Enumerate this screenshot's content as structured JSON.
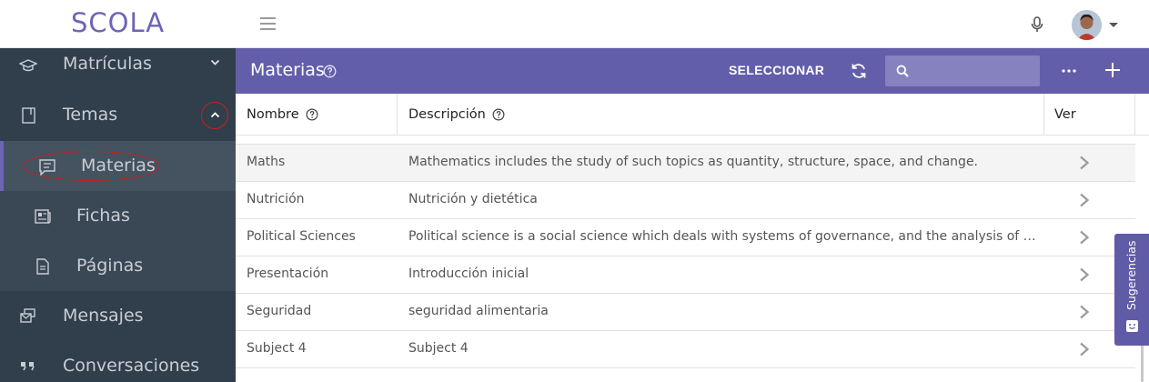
{
  "header": {
    "logo": "SCOLA"
  },
  "sidebar": {
    "items": [
      {
        "label": "Matrículas",
        "icon": "graduation-cap-icon"
      },
      {
        "label": "Temas",
        "icon": "book-icon"
      },
      {
        "label": "Materias",
        "icon": "chat-list-icon"
      },
      {
        "label": "Fichas",
        "icon": "newspaper-icon"
      },
      {
        "label": "Páginas",
        "icon": "document-icon"
      },
      {
        "label": "Mensajes",
        "icon": "messages-icon"
      },
      {
        "label": "Conversaciones",
        "icon": "quote-icon"
      }
    ]
  },
  "content": {
    "title": "Materias",
    "select_label": "SELECCIONAR",
    "search_placeholder": ""
  },
  "table": {
    "columns": [
      "Nombre",
      "Descripción",
      "Ver"
    ],
    "rows": [
      {
        "name": "Maths",
        "description": "Mathematics includes the study of such topics as quantity, structure, space, and change."
      },
      {
        "name": "Nutrición",
        "description": "Nutrición y dietética"
      },
      {
        "name": "Political Sciences",
        "description": "Political science is a social science which deals with systems of governance, and the analysis of political activities"
      },
      {
        "name": "Presentación",
        "description": "Introducción inicial"
      },
      {
        "name": "Seguridad",
        "description": "seguridad alimentaria"
      },
      {
        "name": "Subject 4",
        "description": "Subject 4"
      }
    ]
  },
  "feedback": {
    "label": "Sugerencias"
  },
  "colors": {
    "brand": "#6c65b6",
    "header_bar": "#625ea9",
    "sidebar": "#313e4b",
    "annotation": "#cc1f1f"
  }
}
